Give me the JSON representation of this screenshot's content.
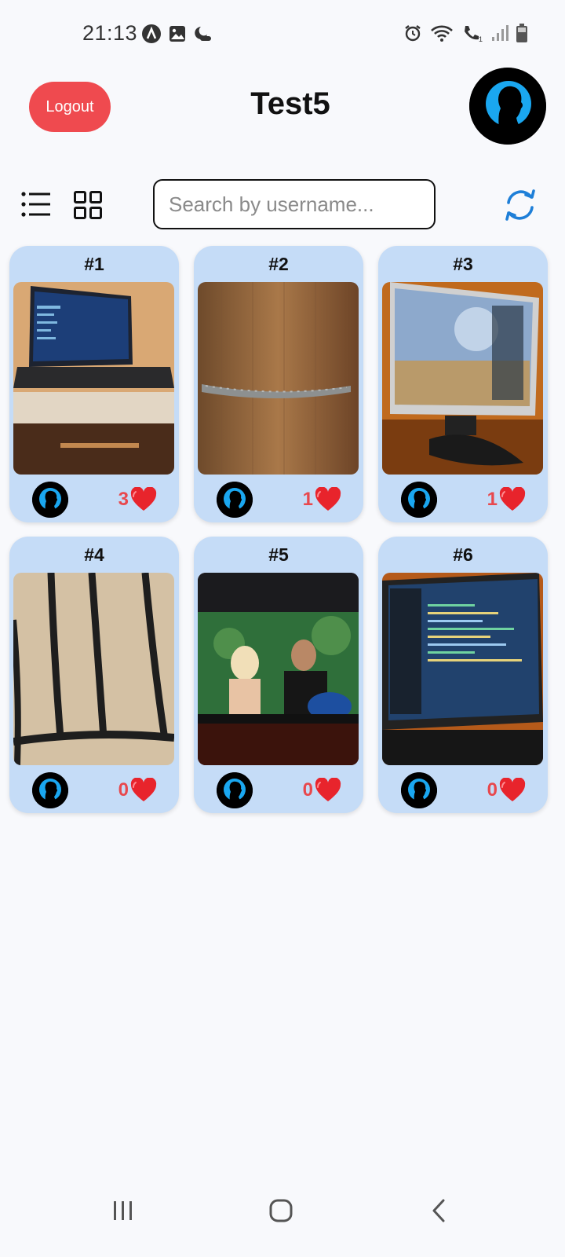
{
  "status_bar": {
    "time": "21:13",
    "left_icons": [
      "notification-a-icon",
      "gallery-icon",
      "weather-icon"
    ],
    "right_icons": [
      "alarm-icon",
      "wifi-icon",
      "volte-call-icon",
      "signal-icon",
      "battery-icon"
    ]
  },
  "header": {
    "logout_label": "Logout",
    "title": "Test5",
    "avatar_icon": "user-silhouette-icon"
  },
  "toolbar": {
    "list_view_icon": "list-icon",
    "grid_view_icon": "grid-icon",
    "search_placeholder": "Search by username...",
    "search_value": "",
    "refresh_icon": "refresh-icon"
  },
  "posts": [
    {
      "number": "#1",
      "likes": "3",
      "image": "laptop-on-desk-photo"
    },
    {
      "number": "#2",
      "likes": "1",
      "image": "wooden-door-handle-photo"
    },
    {
      "number": "#3",
      "likes": "1",
      "image": "monitor-game-screen-photo"
    },
    {
      "number": "#4",
      "likes": "0",
      "image": "striped-fabric-photo"
    },
    {
      "number": "#5",
      "likes": "0",
      "image": "tv-show-couple-photo"
    },
    {
      "number": "#6",
      "likes": "0",
      "image": "monitor-code-editor-photo"
    }
  ],
  "colors": {
    "card_background": "#c5dcf7",
    "logout_red": "#ef4a4f",
    "like_red": "#e8484d",
    "accent_blue": "#1e7fd8",
    "avatar_blue": "#1aa7f0"
  },
  "nav_bar": {
    "icons": [
      "recent-apps-icon",
      "home-icon",
      "back-icon"
    ]
  }
}
